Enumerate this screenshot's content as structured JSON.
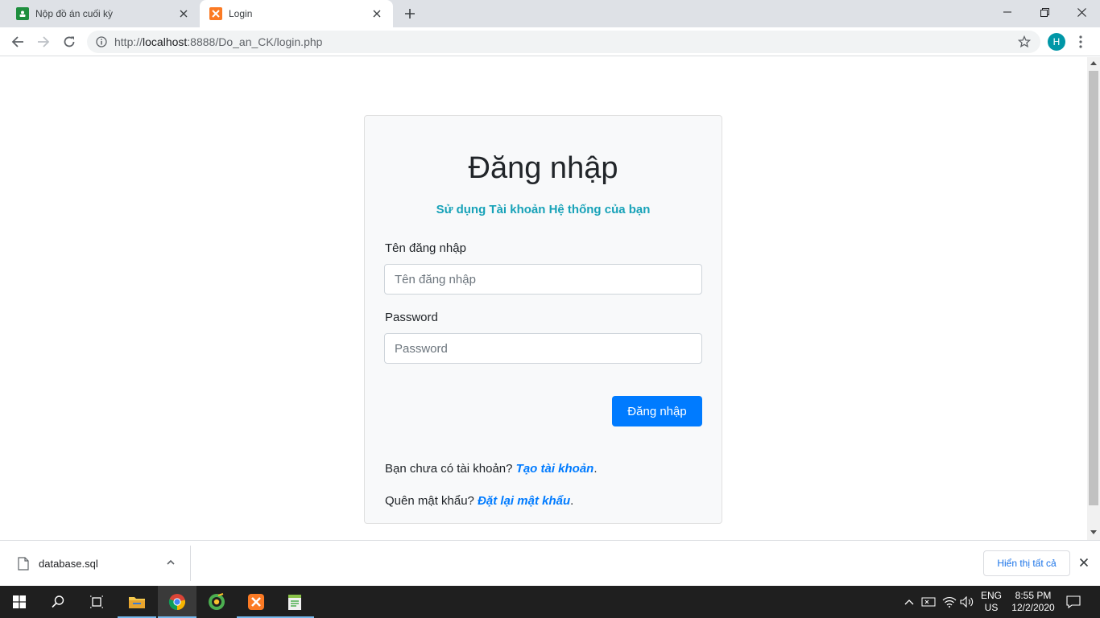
{
  "browser": {
    "tabs": [
      {
        "title": "Nộp đồ án cuối kỳ",
        "active": false
      },
      {
        "title": "Login",
        "active": true
      }
    ],
    "url_prefix": "http://",
    "url_host": "localhost",
    "url_rest": ":8888/Do_an_CK/login.php",
    "profile_initial": "H"
  },
  "page": {
    "heading": "Đăng nhập",
    "subheading": "Sử dụng Tài khoản Hệ thống của bạn",
    "username_label": "Tên đăng nhập",
    "username_placeholder": "Tên đăng nhập",
    "password_label": "Password",
    "password_placeholder": "Password",
    "submit_label": "Đăng nhập",
    "register_prompt": "Bạn chưa có tài khoản? ",
    "register_link": "Tạo tài khoản",
    "reset_prompt": "Quên mật khẩu? ",
    "reset_link": "Đặt lại mật khẩu",
    "period": "."
  },
  "download_bar": {
    "filename": "database.sql",
    "show_all_label": "Hiển thị tất cả"
  },
  "taskbar": {
    "lang_1": "ENG",
    "lang_2": "US",
    "time": "8:55 PM",
    "date": "12/2/2020"
  },
  "colors": {
    "primary": "#007bff",
    "info": "#17a2b8",
    "card_bg": "#f8f9fa"
  }
}
